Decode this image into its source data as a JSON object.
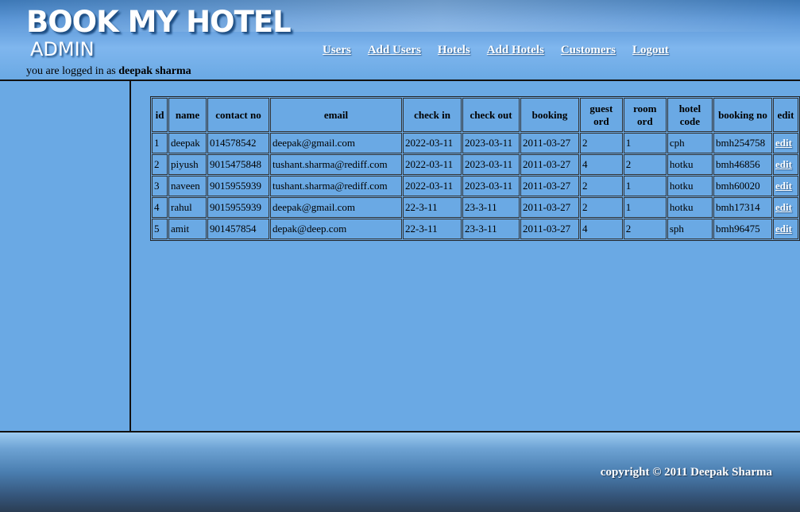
{
  "header": {
    "brand": "BOOK MY HOTEL",
    "subbrand": "ADMIN",
    "nav": [
      "Users",
      "Add Users",
      "Hotels",
      "Add Hotels",
      "Customers",
      "Logout"
    ],
    "login_prefix": "you are logged in as",
    "login_user": "deepak sharma"
  },
  "table": {
    "headers": [
      "id",
      "name",
      "contact no",
      "email",
      "check in",
      "check out",
      "booking",
      "guest ord",
      "room ord",
      "hotel code",
      "booking no",
      "edit"
    ],
    "rows": [
      [
        "1",
        "deepak",
        "014578542",
        "deepak@gmail.com",
        "2022-03-11",
        "2023-03-11",
        "2011-03-27",
        "2",
        "1",
        "cph",
        "bmh254758",
        "edit"
      ],
      [
        "2",
        "piyush",
        "9015475848",
        "tushant.sharma@rediff.com",
        "2022-03-11",
        "2023-03-11",
        "2011-03-27",
        "4",
        "2",
        "hotku",
        "bmh46856",
        "edit"
      ],
      [
        "3",
        "naveen",
        "9015955939",
        "tushant.sharma@rediff.com",
        "2022-03-11",
        "2023-03-11",
        "2011-03-27",
        "2",
        "1",
        "hotku",
        "bmh60020",
        "edit"
      ],
      [
        "4",
        "rahul",
        "9015955939",
        "deepak@gmail.com",
        "22-3-11",
        "23-3-11",
        "2011-03-27",
        "2",
        "1",
        "hotku",
        "bmh17314",
        "edit"
      ],
      [
        "5",
        "amit",
        "901457854",
        "depak@deep.com",
        "22-3-11",
        "23-3-11",
        "2011-03-27",
        "4",
        "2",
        "sph",
        "bmh96475",
        "edit"
      ]
    ]
  },
  "footer": {
    "copyright": "copyright © 2011 Deepak Sharma"
  }
}
